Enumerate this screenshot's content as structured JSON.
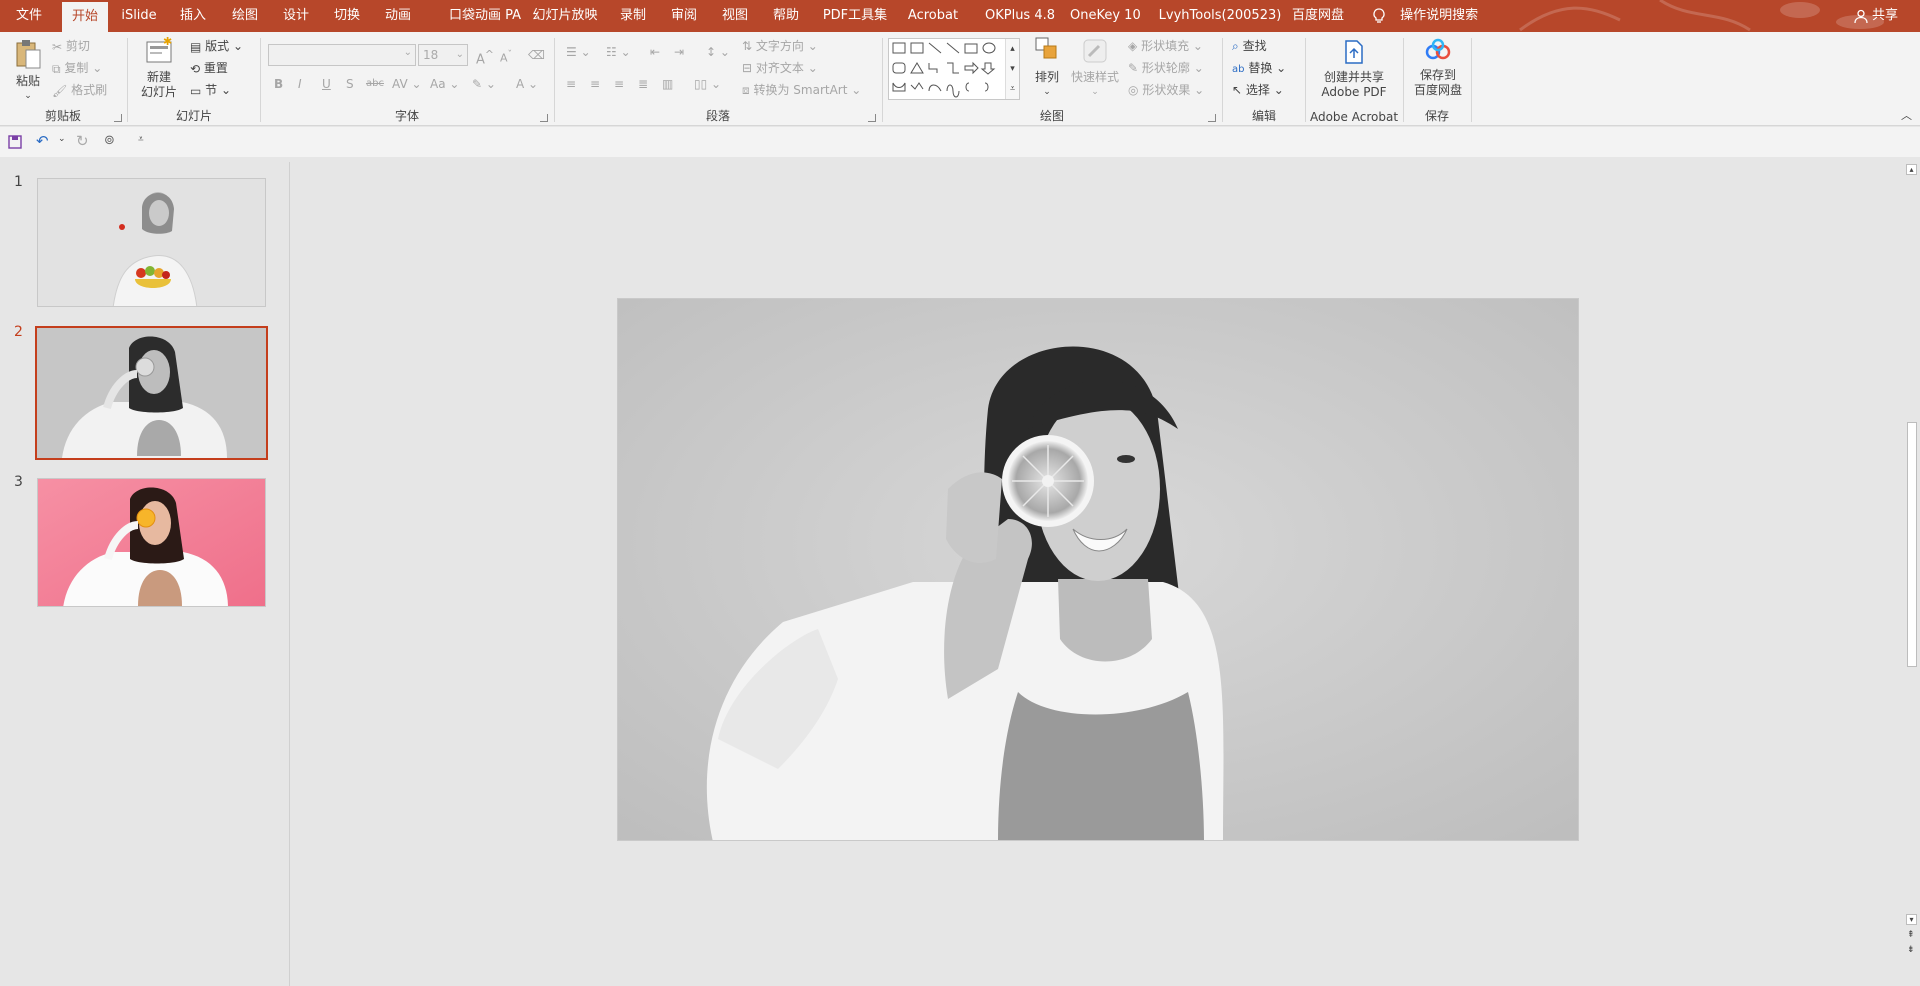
{
  "tabs": [
    "文件",
    "开始",
    "iSlide",
    "插入",
    "绘图",
    "设计",
    "切换",
    "动画",
    "口袋动画 PA",
    "幻灯片放映",
    "录制",
    "审阅",
    "视图",
    "帮助",
    "PDF工具集",
    "Acrobat",
    "OKPlus 4.8",
    "OneKey 10",
    "LvyhTools(200523)",
    "百度网盘"
  ],
  "tell_me": "操作说明搜索",
  "share": "共享",
  "theme": {
    "accent": "#b7472a",
    "selected": "#c43e1c"
  },
  "ribbon": {
    "clipboard": {
      "paste": "粘贴",
      "cut": "剪切",
      "copy": "复制",
      "format_painter": "格式刷",
      "label": "剪贴板"
    },
    "slides": {
      "new_slide_1": "新建",
      "new_slide_2": "幻灯片",
      "layout": "版式",
      "reset": "重置",
      "section": "节",
      "label": "幻灯片"
    },
    "font": {
      "size": "18",
      "bold": "B",
      "italic": "I",
      "underline": "U",
      "shadow": "S",
      "strike": "abc",
      "spacing": "AV",
      "case": "Aa",
      "color": "A",
      "grow": "A",
      "shrink": "A",
      "label": "字体"
    },
    "paragraph": {
      "text_direction": "文字方向",
      "align_text": "对齐文本",
      "smartart": "转换为 SmartArt",
      "label": "段落"
    },
    "drawing": {
      "arrange": "排列",
      "quick_styles": "快速样式",
      "fill": "形状填充",
      "outline": "形状轮廓",
      "effects": "形状效果",
      "label": "绘图"
    },
    "editing": {
      "find": "查找",
      "replace": "替换",
      "select": "选择",
      "label": "编辑"
    },
    "acrobat": {
      "create_1": "创建并共享",
      "create_2": "Adobe PDF",
      "label": "Adobe Acrobat"
    },
    "save": {
      "save_1": "保存到",
      "save_2": "百度网盘",
      "label": "保存"
    }
  },
  "slides": [
    {
      "number": "1"
    },
    {
      "number": "2"
    },
    {
      "number": "3"
    }
  ]
}
